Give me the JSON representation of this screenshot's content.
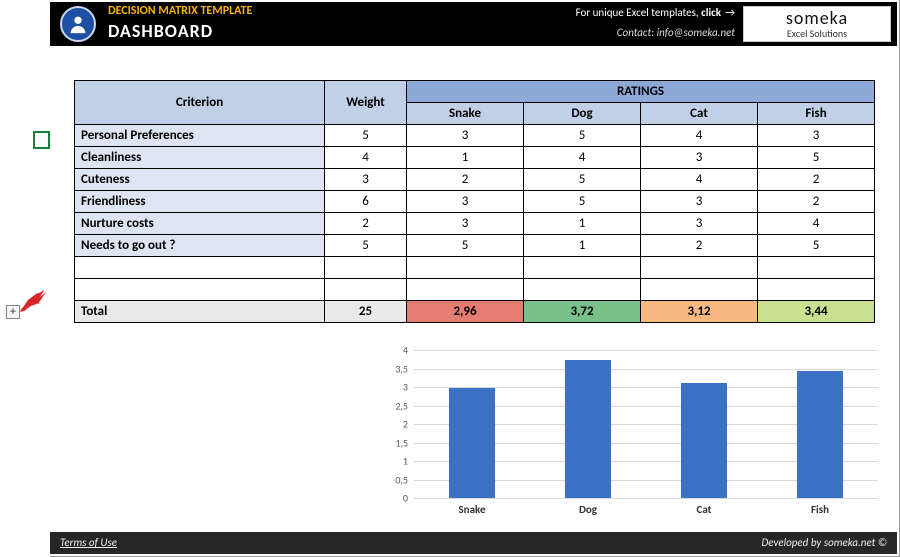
{
  "header": {
    "title": "DECISION MATRIX TEMPLATE",
    "subtitle": "DASHBOARD",
    "clickText": "For unique Excel templates, ",
    "clickBold": "click",
    "arrow": "→",
    "contact": "Contact: info@someka.net",
    "logo_line1": "someka",
    "logo_line2": "Excel Solutions"
  },
  "columns": {
    "criterion": "Criterion",
    "weight": "Weight",
    "ratings": "RATINGS",
    "options": [
      "Snake",
      "Dog",
      "Cat",
      "Fish"
    ]
  },
  "rows": [
    {
      "name": "Personal Preferences",
      "weight": 5,
      "vals": [
        3,
        5,
        4,
        3
      ]
    },
    {
      "name": "Cleanliness",
      "weight": 4,
      "vals": [
        1,
        4,
        3,
        5
      ]
    },
    {
      "name": "Cuteness",
      "weight": 3,
      "vals": [
        2,
        5,
        4,
        2
      ]
    },
    {
      "name": "Friendliness",
      "weight": 6,
      "vals": [
        3,
        5,
        3,
        2
      ]
    },
    {
      "name": "Nurture costs",
      "weight": 2,
      "vals": [
        3,
        1,
        3,
        4
      ]
    },
    {
      "name": "Needs to go out ?",
      "weight": 5,
      "vals": [
        5,
        1,
        2,
        5
      ]
    }
  ],
  "total": {
    "label": "Total",
    "weight": "25",
    "scores": [
      "2,96",
      "3,72",
      "3,12",
      "3,44"
    ]
  },
  "score_colors": [
    "#e67d73",
    "#79c18b",
    "#f7b980",
    "#c8e091"
  ],
  "chart_data": {
    "type": "bar",
    "categories": [
      "Snake",
      "Dog",
      "Cat",
      "Fish"
    ],
    "values": [
      2.96,
      3.72,
      3.12,
      3.44
    ],
    "title": "",
    "xlabel": "",
    "ylabel": "",
    "ylim": [
      0,
      4
    ],
    "yticks": [
      0,
      0.5,
      1,
      1.5,
      2,
      2.5,
      3,
      3.5,
      4
    ],
    "ytick_labels": [
      "0",
      "0,5",
      "1",
      "1,5",
      "2",
      "2,5",
      "3",
      "3,5",
      "4"
    ]
  },
  "footer": {
    "terms": "Terms of Use",
    "dev": "Developed by someka.net ©"
  },
  "expand": "+"
}
